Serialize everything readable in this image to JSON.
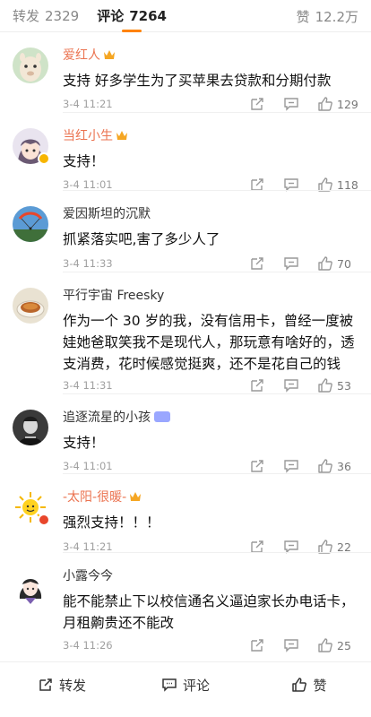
{
  "tabs": {
    "repost": {
      "label": "转发",
      "count": "2329"
    },
    "comment": {
      "label": "评论",
      "count": "7264"
    },
    "like": {
      "label": "赞",
      "count": "12.2万"
    }
  },
  "accent_color": "#ff8200",
  "comments": [
    {
      "name": "爱红人",
      "text": "支持 好多学生为了买苹果去贷款和分期付款",
      "time": "3-4 11:21",
      "likes": "129",
      "avatar_icon": "alpaca-avatar"
    },
    {
      "name": "当红小生",
      "text": "支持！",
      "time": "3-4 11:01",
      "likes": "118",
      "avatar_icon": "anime-girl-avatar"
    },
    {
      "name": "爱因斯坦的沉默",
      "text": "抓紧落实吧,害了多少人了",
      "time": "3-4 11:33",
      "likes": "70",
      "avatar_icon": "paraglider-avatar"
    },
    {
      "name": "平行宇宙 Freesky",
      "text": "作为一个 30 岁的我，没有信用卡，曾经一度被娃她爸取笑我不是现代人，那玩意有啥好的，透支消费，花时候感觉挺爽，还不是花自己的钱",
      "time": "3-4 11:31",
      "likes": "53",
      "avatar_icon": "tea-cup-avatar"
    },
    {
      "name": "追逐流星的小孩",
      "text": "支持！",
      "time": "3-4 11:01",
      "likes": "36",
      "avatar_icon": "portrait-avatar"
    },
    {
      "name": "-太阳-很暖-",
      "text": "强烈支持！！！",
      "time": "3-4 11:21",
      "likes": "22",
      "avatar_icon": "sun-avatar"
    },
    {
      "name": "小露今今",
      "text": "能不能禁止下以校信通名义逼迫家长办电话卡，月租齁贵还不能改",
      "time": "3-4 11:26",
      "likes": "25",
      "avatar_icon": "cartoon-girl-avatar"
    }
  ],
  "toolbar": {
    "repost": "转发",
    "comment": "评论",
    "like": "赞"
  }
}
